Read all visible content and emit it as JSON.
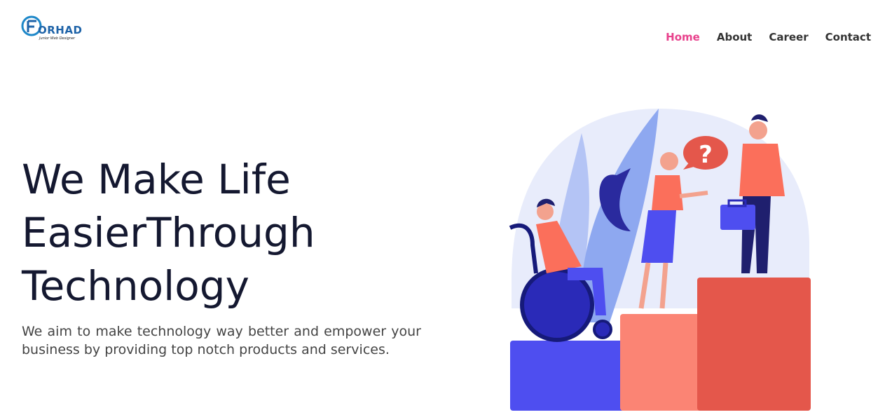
{
  "logo": {
    "text": "ORHAD",
    "tagline": "Junior Web Designer"
  },
  "nav": {
    "items": [
      {
        "label": "Home",
        "active": true
      },
      {
        "label": "About",
        "active": false
      },
      {
        "label": "Career",
        "active": false
      },
      {
        "label": "Contact",
        "active": false
      }
    ]
  },
  "hero": {
    "title_lines": [
      "We Make Life",
      "EasierThrough",
      "Technology"
    ],
    "description": "We aim to make technology way better and empower your business by providing top notch products and services."
  },
  "colors": {
    "accent": "#e8418c",
    "heading": "#141830",
    "body_text": "#444444"
  },
  "illustration": {
    "question_mark": "?"
  }
}
